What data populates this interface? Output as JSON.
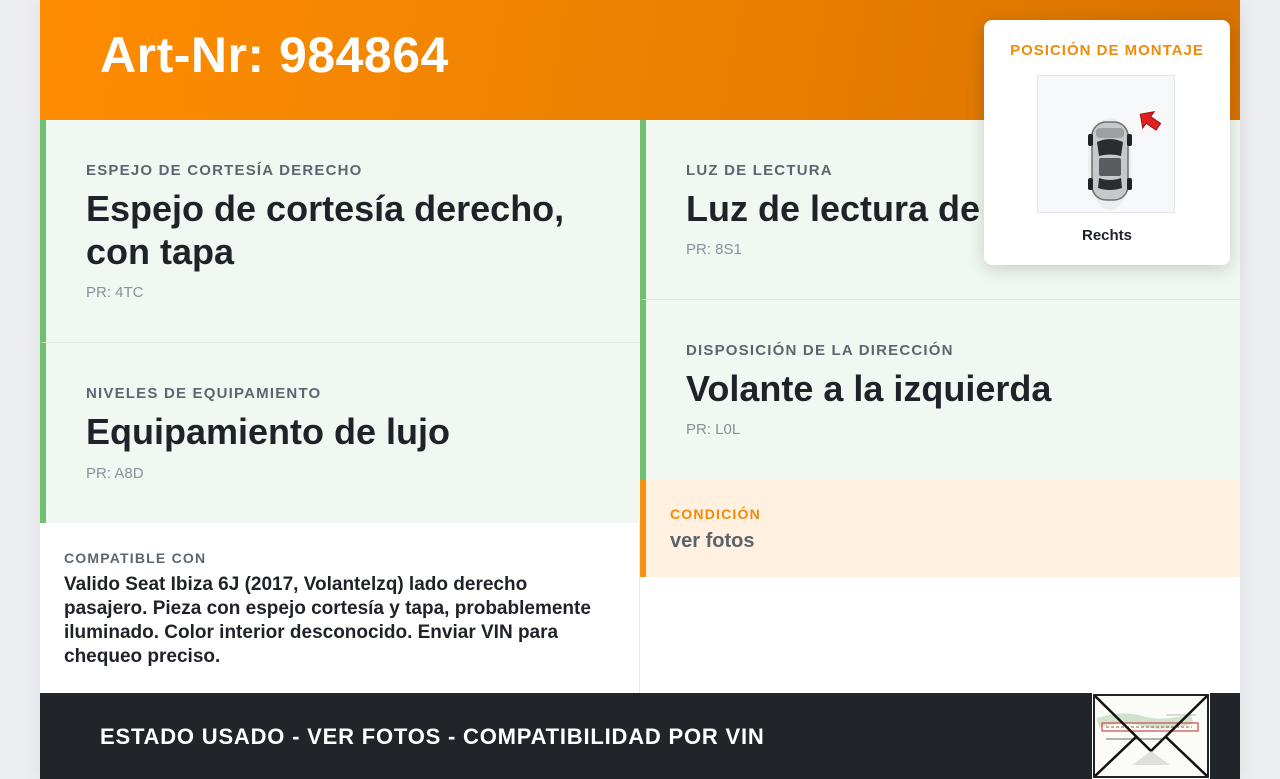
{
  "header": {
    "title": "Art-Nr: 984864"
  },
  "cards": [
    {
      "label": "ESPEJO DE CORTESÍA DERECHO",
      "value": "Espejo de cortesía derecho, con tapa",
      "pr": "PR: 4TC"
    },
    {
      "label": "NIVELES DE EQUIPAMIENTO",
      "value": "Equipamiento de lujo",
      "pr": "PR: A8D"
    },
    {
      "label": "LUZ DE LECTURA",
      "value": "Luz de lectura de",
      "pr": "PR: 8S1"
    },
    {
      "label": "DISPOSICIÓN DE LA DIRECCIÓN",
      "value": "Volante a la izquierda",
      "pr": "PR: L0L"
    }
  ],
  "compatible": {
    "label": "COMPATIBLE CON",
    "text": "Valido Seat Ibiza 6J (2017, Volantelzq) lado derecho pasajero. Pieza con espejo cortesía y tapa, probablemente iluminado. Color interior desconocido. Enviar VIN para chequeo preciso."
  },
  "condition": {
    "label": "CONDICIÓN",
    "value": "ver fotos"
  },
  "mounting": {
    "title": "POSICIÓN DE MONTAJE",
    "side": "Rechts",
    "icon": "car-top-view-icon"
  },
  "footer": {
    "text": "ESTADO USADO - VER FOTOS - COMPATIBILIDAD POR VIN",
    "stamp_icon": "document-envelope-icon"
  },
  "colors": {
    "accent": "#ff8c00",
    "green": "#6cc070",
    "dark": "#212429",
    "cond_bg": "#fff0df"
  }
}
